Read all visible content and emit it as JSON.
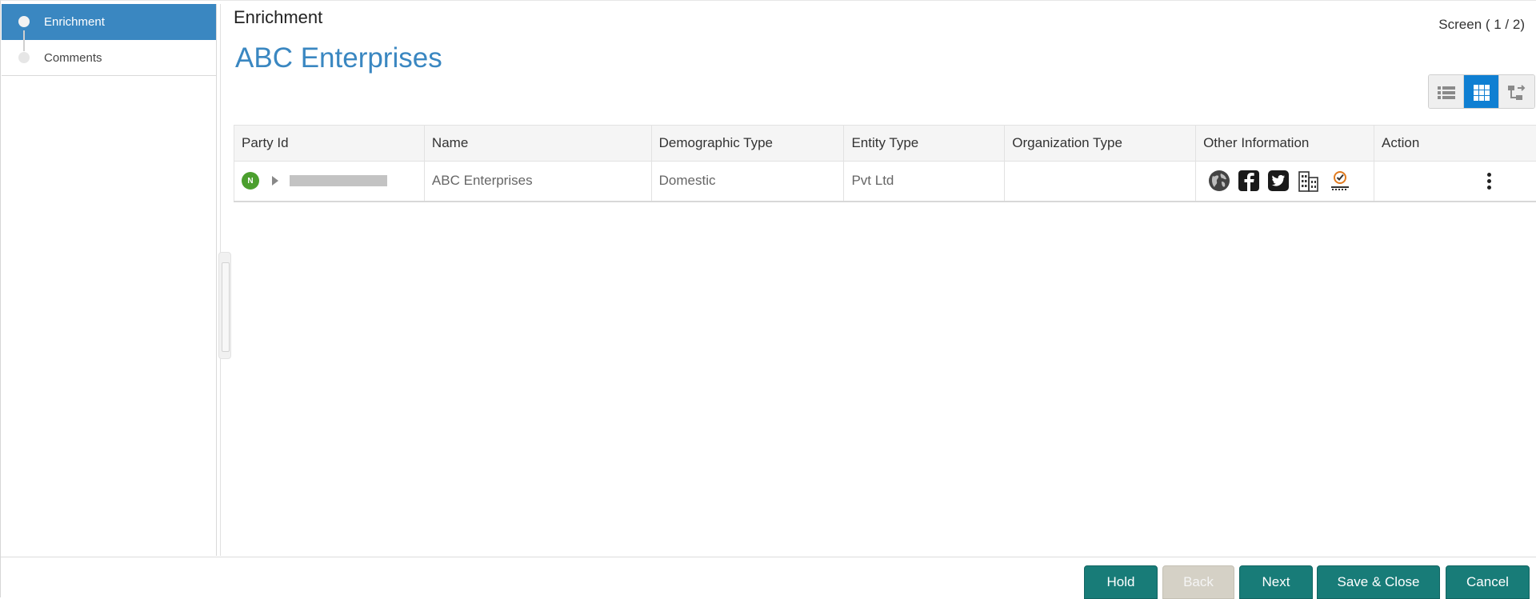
{
  "sidebar": {
    "steps": [
      {
        "label": "Enrichment",
        "state": "active"
      },
      {
        "label": "Comments",
        "state": "inactive"
      }
    ]
  },
  "header": {
    "section_title": "Enrichment",
    "screen_counter": "Screen ( 1 / 2)",
    "entity_title": "ABC Enterprises"
  },
  "view_toggle": {
    "options": [
      "list-view-icon",
      "grid-view-icon",
      "tree-view-icon"
    ],
    "selected": "grid-view-icon"
  },
  "table": {
    "columns": [
      "Party Id",
      "Name",
      "Demographic Type",
      "Entity Type",
      "Organization Type",
      "Other Information",
      "Action"
    ],
    "rows": [
      {
        "badge": "N",
        "party_id": "",
        "name": "ABC Enterprises",
        "demographic_type": "Domestic",
        "entity_type": "Pvt Ltd",
        "organization_type": "",
        "other_information_icons": [
          "globe-icon",
          "facebook-icon",
          "twitter-icon",
          "building-icon",
          "rating-icon"
        ]
      }
    ]
  },
  "footer": {
    "hold": "Hold",
    "back": "Back",
    "next": "Next",
    "save_close": "Save & Close",
    "cancel": "Cancel"
  },
  "colors": {
    "accent": "#3a87c1",
    "button_primary": "#187c78",
    "button_disabled": "#d5d1c6",
    "badge_new": "#4b9f2e",
    "toggle_active": "#0f7fd2"
  }
}
